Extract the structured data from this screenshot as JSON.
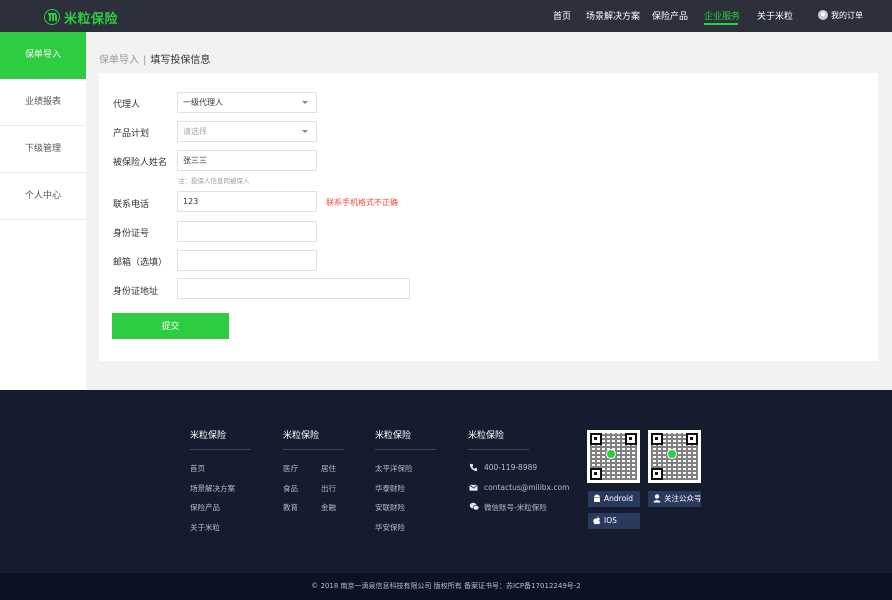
{
  "header": {
    "logo_text": "米粒保险",
    "nav": [
      {
        "label": "首页",
        "active": false
      },
      {
        "label": "场景解决方案",
        "active": false
      },
      {
        "label": "保险产品",
        "active": false
      },
      {
        "label": "企业服务",
        "active": true
      },
      {
        "label": "关于米粒",
        "active": false
      }
    ],
    "user_label": "我的订单"
  },
  "sidebar": {
    "items": [
      {
        "label": "保单导入",
        "active": true
      },
      {
        "label": "业绩报表",
        "active": false
      },
      {
        "label": "下级管理",
        "active": false
      },
      {
        "label": "个人中心",
        "active": false
      }
    ]
  },
  "breadcrumb": {
    "parent": "保单导入",
    "separator": "|",
    "current": "填写投保信息"
  },
  "form": {
    "agent_label": "代理人",
    "agent_value": "一级代理人",
    "plan_label": "产品计划",
    "plan_placeholder": "请选择",
    "insured_name_label": "被保险人姓名",
    "insured_name_value": "张三三",
    "insured_name_hint": "注：投保人信息同被保人",
    "phone_label": "联系电话",
    "phone_value": "123",
    "phone_error": "联系手机格式不正确",
    "id_label": "身份证号",
    "id_value": "",
    "email_label": "邮箱（选填）",
    "email_value": "",
    "address_label": "身份证地址",
    "address_value": "",
    "submit_label": "提交"
  },
  "footer": {
    "columns": [
      {
        "title": "米粒保险",
        "links": [
          "首页",
          "场景解决方案",
          "保险产品",
          "关于米粒"
        ]
      },
      {
        "title": "米粒保险",
        "links": [
          "医疗",
          "居住",
          "食品",
          "出行",
          "教育",
          "金融"
        ]
      },
      {
        "title": "米粒保险",
        "links": [
          "太平洋保险",
          "华泰财险",
          "安联财险",
          "华安保险"
        ]
      }
    ],
    "contact": {
      "title": "米粒保险",
      "phone": "400-119-8989",
      "email": "contactus@milibx.com",
      "wechat": "微信账号-米粒保险"
    },
    "badges": {
      "android": "Android",
      "follow": "关注公众号",
      "ios": "IOS"
    },
    "copyright": "© 2018 南京一滴泉信息科技有限公司 版权所有 备案证书号：苏ICP备17012249号-2"
  },
  "colors": {
    "accent": "#2ecc40",
    "header_bg": "#2b303b",
    "footer_bg": "#141c2e",
    "error": "#f04b3c"
  }
}
